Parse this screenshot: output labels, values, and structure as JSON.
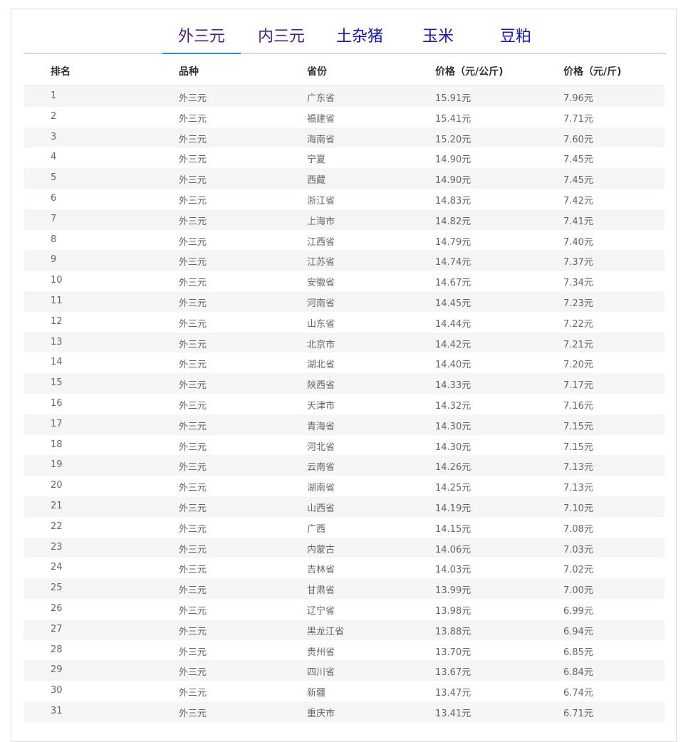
{
  "tabs": [
    {
      "label": "外三元",
      "state": "active"
    },
    {
      "label": "内三元",
      "state": "visited"
    },
    {
      "label": "土杂猪",
      "state": "link"
    },
    {
      "label": "玉米",
      "state": "link"
    },
    {
      "label": "豆粕",
      "state": "link"
    }
  ],
  "table": {
    "headers": [
      "排名",
      "品种",
      "省份",
      "价格（元/公斤)",
      "价格（元/斤)"
    ],
    "rows": [
      [
        "1",
        "外三元",
        "广东省",
        "15.91元",
        "7.96元"
      ],
      [
        "2",
        "外三元",
        "福建省",
        "15.41元",
        "7.71元"
      ],
      [
        "3",
        "外三元",
        "海南省",
        "15.20元",
        "7.60元"
      ],
      [
        "4",
        "外三元",
        "宁夏",
        "14.90元",
        "7.45元"
      ],
      [
        "5",
        "外三元",
        "西藏",
        "14.90元",
        "7.45元"
      ],
      [
        "6",
        "外三元",
        "浙江省",
        "14.83元",
        "7.42元"
      ],
      [
        "7",
        "外三元",
        "上海市",
        "14.82元",
        "7.41元"
      ],
      [
        "8",
        "外三元",
        "江西省",
        "14.79元",
        "7.40元"
      ],
      [
        "9",
        "外三元",
        "江苏省",
        "14.74元",
        "7.37元"
      ],
      [
        "10",
        "外三元",
        "安徽省",
        "14.67元",
        "7.34元"
      ],
      [
        "11",
        "外三元",
        "河南省",
        "14.45元",
        "7.23元"
      ],
      [
        "12",
        "外三元",
        "山东省",
        "14.44元",
        "7.22元"
      ],
      [
        "13",
        "外三元",
        "北京市",
        "14.42元",
        "7.21元"
      ],
      [
        "14",
        "外三元",
        "湖北省",
        "14.40元",
        "7.20元"
      ],
      [
        "15",
        "外三元",
        "陕西省",
        "14.33元",
        "7.17元"
      ],
      [
        "16",
        "外三元",
        "天津市",
        "14.32元",
        "7.16元"
      ],
      [
        "17",
        "外三元",
        "青海省",
        "14.30元",
        "7.15元"
      ],
      [
        "18",
        "外三元",
        "河北省",
        "14.30元",
        "7.15元"
      ],
      [
        "19",
        "外三元",
        "云南省",
        "14.26元",
        "7.13元"
      ],
      [
        "20",
        "外三元",
        "湖南省",
        "14.25元",
        "7.13元"
      ],
      [
        "21",
        "外三元",
        "山西省",
        "14.19元",
        "7.10元"
      ],
      [
        "22",
        "外三元",
        "广西",
        "14.15元",
        "7.08元"
      ],
      [
        "23",
        "外三元",
        "内蒙古",
        "14.06元",
        "7.03元"
      ],
      [
        "24",
        "外三元",
        "吉林省",
        "14.03元",
        "7.02元"
      ],
      [
        "25",
        "外三元",
        "甘肃省",
        "13.99元",
        "7.00元"
      ],
      [
        "26",
        "外三元",
        "辽宁省",
        "13.98元",
        "6.99元"
      ],
      [
        "27",
        "外三元",
        "黑龙江省",
        "13.88元",
        "6.94元"
      ],
      [
        "28",
        "外三元",
        "贵州省",
        "13.70元",
        "6.85元"
      ],
      [
        "29",
        "外三元",
        "四川省",
        "13.67元",
        "6.84元"
      ],
      [
        "30",
        "外三元",
        "新疆",
        "13.47元",
        "6.74元"
      ],
      [
        "31",
        "外三元",
        "重庆市",
        "13.41元",
        "6.71元"
      ]
    ]
  }
}
